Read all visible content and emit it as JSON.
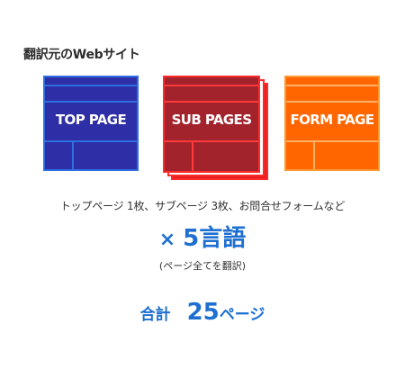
{
  "heading": "翻訳元のWebサイト",
  "cards": [
    {
      "label": "TOP PAGE",
      "color": "#2e2ea6"
    },
    {
      "label": "SUB PAGES",
      "color": "#a3232d"
    },
    {
      "label": "FORM PAGE",
      "color": "#ff6600"
    }
  ],
  "description": "トップページ 1枚、サブページ 3枚、お問合せフォームなど",
  "multiplier": {
    "symbol": "×",
    "value": "5言語"
  },
  "note": "(ページ全てを翻訳)",
  "total": {
    "label": "合計",
    "number": "25",
    "unit": "ページ"
  },
  "accent_color": "#1e6fd0"
}
